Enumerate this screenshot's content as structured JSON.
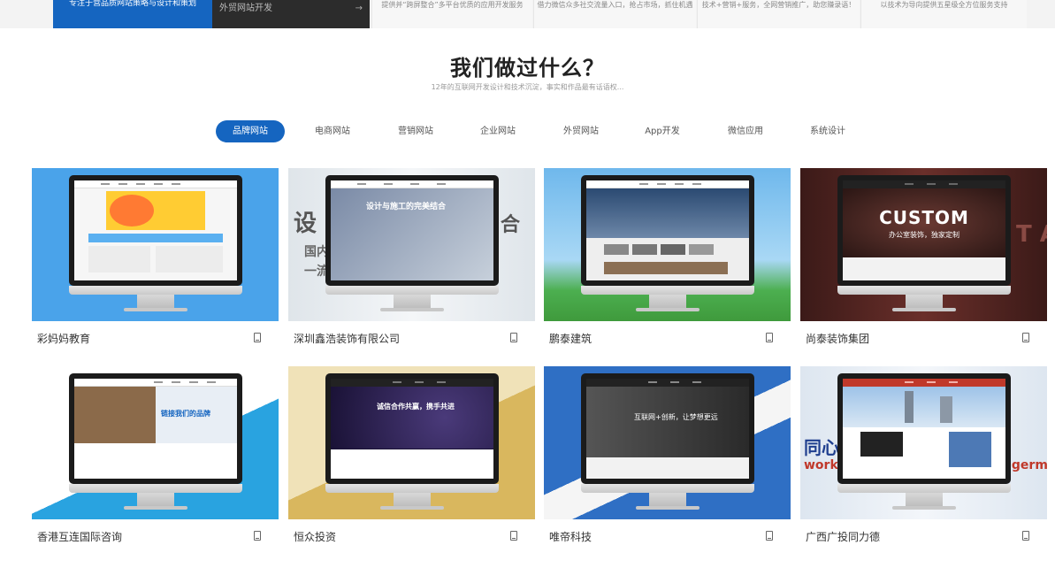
{
  "top_strip": {
    "blue_text": "专注于营品质网站策略与设计和策划",
    "dark_label": "外贸网站开发",
    "arrow": "→",
    "columns": [
      "提供并“跨屏整合”多平台优质的应用开发服务",
      "借力微信众多社交流量入口，抢占市场，抓住机遇",
      "技术+营销+服务，全网营销推广，助您赚录语！",
      "以技术为导向提供五星级全方位服务支持"
    ]
  },
  "section": {
    "title": "我们做过什么？",
    "subtitle": "12年的互联网开发设计和技术沉淀，事实和作品最有话语权..."
  },
  "tabs": [
    "品牌网站",
    "电商网站",
    "营销网站",
    "企业网站",
    "外贸网站",
    "App开发",
    "微信应用",
    "系统设计"
  ],
  "active_tab": "品牌网站",
  "cards": [
    {
      "title": "彩妈妈教育",
      "screen_text": "",
      "bg": "#4aa3ea"
    },
    {
      "title": "深圳鑫浩装饰有限公司",
      "screen_text": "设计与施工的完美结合",
      "bg": "#e8ecef",
      "overlay_left": "设",
      "overlay_right": "合",
      "overlay_sub1": "国内",
      "overlay_sub2": "一流"
    },
    {
      "title": "鹏泰建筑",
      "screen_text": "",
      "bg": "#8ecbf0"
    },
    {
      "title": "尚泰装饰集团",
      "screen_text": "CUSTOM",
      "screen_sub": "办公室装饰，独家定制",
      "bg": "#5a2a26",
      "overlay_right": "T A"
    },
    {
      "title": "香港互连国际咨询",
      "screen_text": "链接我们的品牌",
      "bg": "#29a3e0"
    },
    {
      "title": "恒众投资",
      "screen_text": "诚信合作共赢，携手共进",
      "bg": "#d9b75e"
    },
    {
      "title": "唯帝科技",
      "screen_text": "互联网+创新，让梦想更远",
      "bg": "#2f6fc4"
    },
    {
      "title": "广西广投同力德",
      "screen_text": "",
      "bg": "#eaf0f7",
      "overlay_left": "同心",
      "overlay_left2": "work t",
      "overlay_right": "d germa"
    }
  ],
  "colors": {
    "accent": "#1565c0",
    "dark": "#2c2c2c"
  },
  "icons": {
    "card_icon": "mobile-phone-icon"
  }
}
